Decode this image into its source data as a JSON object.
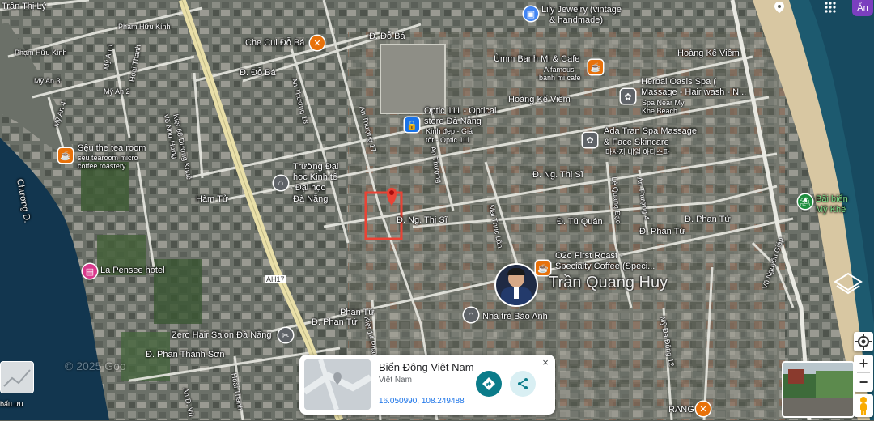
{
  "colors": {
    "land": "#6f756c",
    "street": "#e9e9e2",
    "highway": "#e9dfa8",
    "water": "#12364f",
    "pin_red": "#ea4335",
    "teal": "#0b7c8a",
    "green": "#1e8e3e",
    "orange": "#e8710a",
    "pink": "#d93a8c",
    "blue": "#4285f4"
  },
  "top": {
    "account_initial": "Ăn",
    "apps_icon": "apps-grid-icon",
    "location_icon": "location-pin-icon"
  },
  "streets": {
    "tran_thi_ly": "Trần Thị Lý",
    "pham_huu_kinh": "Phạm Hữu Kính",
    "pham_huu_kinh2": "Phạm Hữu Kính",
    "my_an_3": "Mỹ An 3",
    "my_an_1": "Mỹ An 1",
    "my_an_2": "Mỹ An 2",
    "my_an_4": "Mỹ An 4",
    "hoai_thanh": "Hoài Thanh",
    "do_ba_1": "Đ. Đỗ Bá",
    "do_ba_2": "Đ. Đỗ Bá",
    "an_thuong_17": "An Thượng 17",
    "an_thuong_18": "An Thượng 18",
    "an_thuong_x": "An Thượng",
    "hoang_ke_viem_1": "Hoàng Kế Viêm",
    "hoang_ke_viem_2": "Hoàng Kế Viêm",
    "kiet_vo_nhu_hung": "Kiệt 68 Dương Khuê",
    "vo_nhu_hung": "Võ Như Hưng",
    "chuong_d": "Chương D.",
    "ham_tu": "Hàm Tử",
    "ng_thi_si_1": "Đ. Ng. Thị Sĩ",
    "ng_thi_si_2": "Đ. Ng. Thị Sĩ",
    "mai_thuc_lan": "Mai Thúc Lân",
    "tu_quan": "Đ. Tú Quán",
    "le_quang_dao": "Lê Quang Đạo",
    "an_thuong_4": "An Thượng 4",
    "phan_tu_1": "Đ. Phan Tứ",
    "phan_tu_2": "Đ. Phan Tứ",
    "phan_tu_3": "Đ. Phan Tứ",
    "phan_tu_4": "Phan Tứ",
    "vo_nguyen_giap": "Võ Nguyên Giáp",
    "ah17": "AH17",
    "kiet_14": "Kiệt 14 Phan Tứ",
    "phan_thanh_son": "Đ. Phan Thành Sơn",
    "hoai_thanh_2": "Hoài Thanh",
    "an_d_vu": "An D. Vũ",
    "my_da_dong": "Mỹ Đa Đông 12",
    "rang": "RANG",
    "bau_label": "bấu.ưu"
  },
  "places": {
    "lily": "Lily Jewelry (vintage",
    "lily2": "& handmade)",
    "che_cui": "Che Cui Đỗ Bá",
    "umm": "Ùmm Banh Mi & Cafe",
    "umm_sub1": "A famous",
    "umm_sub2": "banh mi cafe",
    "herbal": "Herbal Oasis Spa (",
    "herbal2": "Massage - Hair wash - N...",
    "herbal_sub1": "Spa Near My",
    "herbal_sub2": "Khe Beach",
    "optic": "Optic 111 - Optical",
    "optic2": "store Đà Nẵng",
    "optic_sub1": "Kính đẹp - Giá",
    "optic_sub2": "tốt - Optic 111",
    "ada": "Ada Tran Spa Massage",
    "ada2": "& Face Skincare",
    "ada_sub": "마사지 네일 아다스파",
    "seu": "Sệu the tea room",
    "seu_sub1": "sẹu tearoom micro",
    "seu_sub2": "coffee roastery",
    "truong": "Trường Đại",
    "truong2": "học Kinh tế",
    "truong3": "- Đại học",
    "truong4": "Đà Nẵng",
    "bien": "Bãi biển",
    "bien2": "Mỹ Khê",
    "pensee": "La Pensee hotel",
    "o2o": "O2o First Roast -",
    "o2o2": "Specialty Coffee (Speci...",
    "nhatre": "Nhà trẻ Bảo Anh",
    "zero": "Zero Hair Salon Đà Nẵng",
    "tran_quang_huy": "Trần Quang Huy",
    "watermark": "© 2025 Goo"
  },
  "card": {
    "title": "Biển Đông Việt Nam",
    "subtitle": "Việt Nam",
    "coords": "16.050990, 108.249488",
    "close": "×"
  },
  "controls": {
    "zoom_in": "+",
    "zoom_out": "−",
    "locate_icon": "my-location-icon",
    "pegman_icon": "pegman-icon",
    "layers_icon": "layers-icon"
  }
}
